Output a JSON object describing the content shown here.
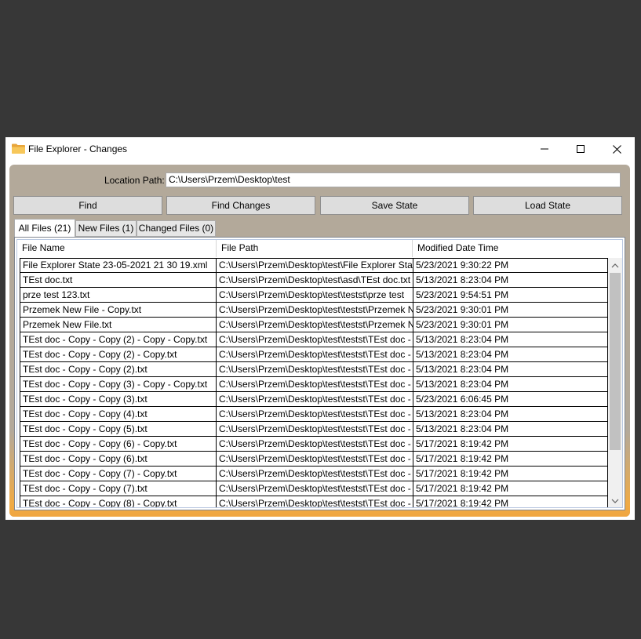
{
  "window": {
    "title": "File Explorer - Changes"
  },
  "location": {
    "label": "Location Path:",
    "value": "C:\\Users\\Przem\\Desktop\\test"
  },
  "buttons": {
    "find": "Find",
    "find_changes": "Find Changes",
    "save_state": "Save State",
    "load_state": "Load State"
  },
  "tabs": {
    "all": "All Files (21)",
    "new": "New Files (1)",
    "changed": "Changed Files (0)"
  },
  "grid": {
    "columns": [
      "File Name",
      "File Path",
      "Modified Date Time"
    ],
    "rows": [
      [
        "File Explorer State 23-05-2021 21 30 19.xml",
        "C:\\Users\\Przem\\Desktop\\test\\File Explorer Sta",
        "5/23/2021 9:30:22 PM"
      ],
      [
        "TEst doc.txt",
        "C:\\Users\\Przem\\Desktop\\test\\asd\\TEst doc.txt",
        "5/13/2021 8:23:04 PM"
      ],
      [
        "prze test 123.txt",
        "C:\\Users\\Przem\\Desktop\\test\\testst\\prze test ",
        "5/23/2021 9:54:51 PM"
      ],
      [
        "Przemek New File - Copy.txt",
        "C:\\Users\\Przem\\Desktop\\test\\testst\\Przemek N",
        "5/23/2021 9:30:01 PM"
      ],
      [
        "Przemek New File.txt",
        "C:\\Users\\Przem\\Desktop\\test\\testst\\Przemek N",
        "5/23/2021 9:30:01 PM"
      ],
      [
        "TEst doc - Copy - Copy (2) - Copy - Copy.txt",
        "C:\\Users\\Przem\\Desktop\\test\\testst\\TEst doc -",
        "5/13/2021 8:23:04 PM"
      ],
      [
        "TEst doc - Copy - Copy (2) - Copy.txt",
        "C:\\Users\\Przem\\Desktop\\test\\testst\\TEst doc -",
        "5/13/2021 8:23:04 PM"
      ],
      [
        "TEst doc - Copy - Copy (2).txt",
        "C:\\Users\\Przem\\Desktop\\test\\testst\\TEst doc -",
        "5/13/2021 8:23:04 PM"
      ],
      [
        "TEst doc - Copy - Copy (3) - Copy - Copy.txt",
        "C:\\Users\\Przem\\Desktop\\test\\testst\\TEst doc -",
        "5/13/2021 8:23:04 PM"
      ],
      [
        "TEst doc - Copy - Copy (3).txt",
        "C:\\Users\\Przem\\Desktop\\test\\testst\\TEst doc -",
        "5/23/2021 6:06:45 PM"
      ],
      [
        "TEst doc - Copy - Copy (4).txt",
        "C:\\Users\\Przem\\Desktop\\test\\testst\\TEst doc -",
        "5/13/2021 8:23:04 PM"
      ],
      [
        "TEst doc - Copy - Copy (5).txt",
        "C:\\Users\\Przem\\Desktop\\test\\testst\\TEst doc -",
        "5/13/2021 8:23:04 PM"
      ],
      [
        "TEst doc - Copy - Copy (6) - Copy.txt",
        "C:\\Users\\Przem\\Desktop\\test\\testst\\TEst doc -",
        "5/17/2021 8:19:42 PM"
      ],
      [
        "TEst doc - Copy - Copy (6).txt",
        "C:\\Users\\Przem\\Desktop\\test\\testst\\TEst doc -",
        "5/17/2021 8:19:42 PM"
      ],
      [
        "TEst doc - Copy - Copy (7) - Copy.txt",
        "C:\\Users\\Przem\\Desktop\\test\\testst\\TEst doc -",
        "5/17/2021 8:19:42 PM"
      ],
      [
        "TEst doc - Copy - Copy (7).txt",
        "C:\\Users\\Przem\\Desktop\\test\\testst\\TEst doc -",
        "5/17/2021 8:19:42 PM"
      ],
      [
        "TEst doc - Copy - Copy (8) - Copy.txt",
        "C:\\Users\\Przem\\Desktop\\test\\testst\\TEst doc -",
        "5/17/2021 8:19:42 PM"
      ]
    ]
  },
  "icons": {
    "app": "folder-icon",
    "minimize": "minimize-icon",
    "maximize": "maximize-icon",
    "close": "close-icon",
    "scroll_up": "chevron-up-icon",
    "scroll_down": "chevron-down-icon"
  },
  "colors": {
    "panel": "#b3a99a",
    "panel_bottom_accent": "#f0a640",
    "desktop_background": "#373737"
  }
}
